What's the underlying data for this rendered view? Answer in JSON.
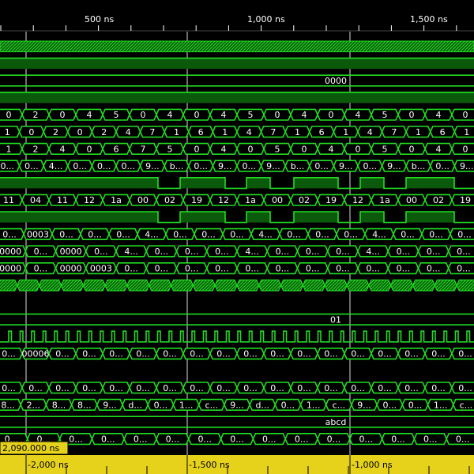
{
  "colors": {
    "signal": "#22dd22",
    "signal_fill": "#0b5a0b",
    "background": "#000000",
    "ruler_bg": "#000000",
    "bottom_ruler_bg": "#e6d21a",
    "cursor_line": "#dddddd",
    "text": "#ffffff"
  },
  "top_ruler": {
    "ticks": [
      {
        "label": "500 ns",
        "t": 500
      },
      {
        "label": "1,000 ns",
        "t": 1000
      },
      {
        "label": "1,500 ns",
        "t": 1500
      }
    ]
  },
  "bottom_ruler": {
    "cursor_time": "2,090.000 ns",
    "ticks": [
      {
        "label": "-2,000 ns",
        "t": 90
      },
      {
        "label": "-1,500 ns",
        "t": 590
      },
      {
        "label": "-1,000 ns",
        "t": 1090
      }
    ]
  },
  "cursors": [
    {
      "t": 90
    },
    {
      "t": 590
    },
    {
      "t": 1090
    }
  ],
  "rows": [
    {
      "name": "row-hatched-0",
      "kind": "hatch"
    },
    {
      "name": "row-flat-1",
      "kind": "flat",
      "level": "high"
    },
    {
      "name": "row-const-0000",
      "kind": "const",
      "value": "0000"
    },
    {
      "name": "row-flat-3",
      "kind": "flat",
      "level": "high"
    },
    {
      "name": "row-bus-a",
      "kind": "bus",
      "values": [
        "0",
        "2",
        "0",
        "4",
        "5",
        "0",
        "4",
        "0",
        "4",
        "5",
        "0",
        "4",
        "0",
        "4",
        "5",
        "0",
        "4",
        "0"
      ]
    },
    {
      "name": "row-bus-b",
      "kind": "bus",
      "values": [
        "1",
        "0",
        "2",
        "0",
        "2",
        "4",
        "7",
        "1",
        "6",
        "1",
        "4",
        "7",
        "1",
        "6",
        "1",
        "4",
        "7",
        "1",
        "6",
        "1"
      ]
    },
    {
      "name": "row-bus-c",
      "kind": "bus",
      "values": [
        "1",
        "2",
        "4",
        "0",
        "6",
        "7",
        "5",
        "0",
        "4",
        "0",
        "5",
        "0",
        "4",
        "0",
        "5",
        "0",
        "4",
        "0"
      ]
    },
    {
      "name": "row-bus-d",
      "kind": "bus",
      "values": [
        "0...",
        "0...",
        "4...",
        "0...",
        "0...",
        "0...",
        "9...",
        "b...",
        "0...",
        "9...",
        "0...",
        "9...",
        "b...",
        "0...",
        "9...",
        "0...",
        "9...",
        "b...",
        "0...",
        "9..."
      ]
    },
    {
      "name": "row-digital-8",
      "kind": "digital"
    },
    {
      "name": "row-bus-e",
      "kind": "bus",
      "values": [
        "11",
        "04",
        "11",
        "12",
        "1a",
        "00",
        "02",
        "19",
        "12",
        "1a",
        "00",
        "02",
        "19",
        "12",
        "1a",
        "00",
        "02",
        "19"
      ]
    },
    {
      "name": "row-digital-10",
      "kind": "digital"
    },
    {
      "name": "row-bus-f",
      "kind": "bus",
      "values": [
        "0...",
        "0003",
        "0...",
        "0...",
        "0...",
        "4...",
        "0...",
        "0...",
        "0...",
        "4...",
        "0...",
        "0...",
        "0...",
        "4...",
        "0...",
        "0...",
        "0..."
      ]
    },
    {
      "name": "row-bus-g",
      "kind": "bus",
      "values": [
        "0000",
        "0...",
        "0000",
        "0...",
        "4...",
        "0...",
        "0...",
        "0...",
        "4...",
        "0...",
        "0...",
        "0...",
        "4...",
        "0...",
        "0...",
        "0..."
      ]
    },
    {
      "name": "row-bus-h",
      "kind": "bus",
      "values": [
        "0000",
        "0...",
        "0000",
        "0003",
        "0...",
        "0...",
        "0...",
        "0...",
        "0...",
        "0...",
        "0...",
        "0...",
        "0...",
        "0...",
        "0...",
        "0..."
      ]
    },
    {
      "name": "row-hatched-14",
      "kind": "hatchbus"
    },
    {
      "name": "row-empty-15",
      "kind": "empty"
    },
    {
      "name": "row-const-01",
      "kind": "const",
      "value": "01"
    },
    {
      "name": "row-clock-17",
      "kind": "clock"
    },
    {
      "name": "row-bus-i",
      "kind": "bus",
      "values": [
        "0...",
        "00006",
        "0...",
        "0...",
        "0...",
        "0...",
        "0...",
        "0...",
        "0...",
        "0...",
        "0...",
        "0...",
        "0...",
        "0...",
        "0...",
        "0...",
        "0...",
        "0..."
      ]
    },
    {
      "name": "row-empty-19",
      "kind": "empty"
    },
    {
      "name": "row-bus-j",
      "kind": "bus",
      "values": [
        "0...",
        "0...",
        "0...",
        "0...",
        "0...",
        "0...",
        "0...",
        "0...",
        "0...",
        "0...",
        "0...",
        "0...",
        "0...",
        "0...",
        "0...",
        "0...",
        "0...",
        "0..."
      ]
    },
    {
      "name": "row-bus-k",
      "kind": "bus",
      "values": [
        "8...",
        "2...",
        "8...",
        "8...",
        "9...",
        "d...",
        "0...",
        "1...",
        "c...",
        "9...",
        "d...",
        "0...",
        "1...",
        "c...",
        "9...",
        "0...",
        "0...",
        "1...",
        "c..."
      ]
    },
    {
      "name": "row-const-abcd",
      "kind": "const",
      "value": "abcd"
    },
    {
      "name": "row-bus-l",
      "kind": "bus",
      "values": [
        "0...",
        "0...",
        "0...",
        "0...",
        "0...",
        "0...",
        "0...",
        "0...",
        "0...",
        "0...",
        "0...",
        "0...",
        "0...",
        "0...",
        "0..."
      ]
    }
  ]
}
